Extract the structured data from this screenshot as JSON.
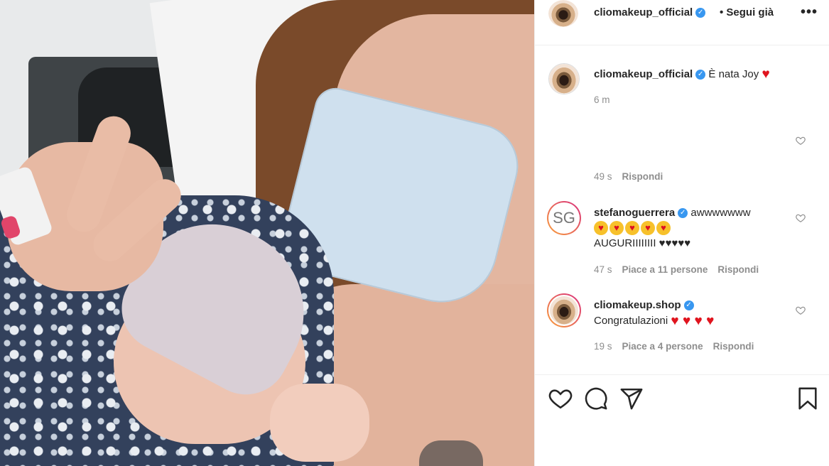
{
  "post": {
    "account": "cliomakeup_official",
    "follow_status": "• Segui già",
    "more": "•••"
  },
  "caption": {
    "username": "cliomakeup_official",
    "text": "È nata Joy",
    "time": "6 m"
  },
  "comments": [
    {
      "username": "",
      "lines": [],
      "time": "49 s",
      "likes": "",
      "reply": "Rispondi"
    },
    {
      "username": "stefanoguerrera",
      "avatar_initials": "SG",
      "text": "awwwwwww",
      "emoji_count": 5,
      "line2": "AUGURIIIIIIII ♥♥♥♥♥",
      "time": "47 s",
      "likes": "Piace a 11 persone",
      "reply": "Rispondi"
    },
    {
      "username": "cliomakeup.shop",
      "text": "Congratulazioni",
      "hearts": "♥ ♥ ♥ ♥",
      "time": "19 s",
      "likes": "Piace a 4 persone",
      "reply": "Rispondi"
    }
  ],
  "icons": [
    "heart-icon",
    "comment-icon",
    "share-icon",
    "bookmark-icon",
    "verified-badge-icon",
    "more-icon"
  ],
  "colors": {
    "verified": "#3897f0",
    "heart": "#e0141e",
    "muted": "#8e8e8e"
  }
}
